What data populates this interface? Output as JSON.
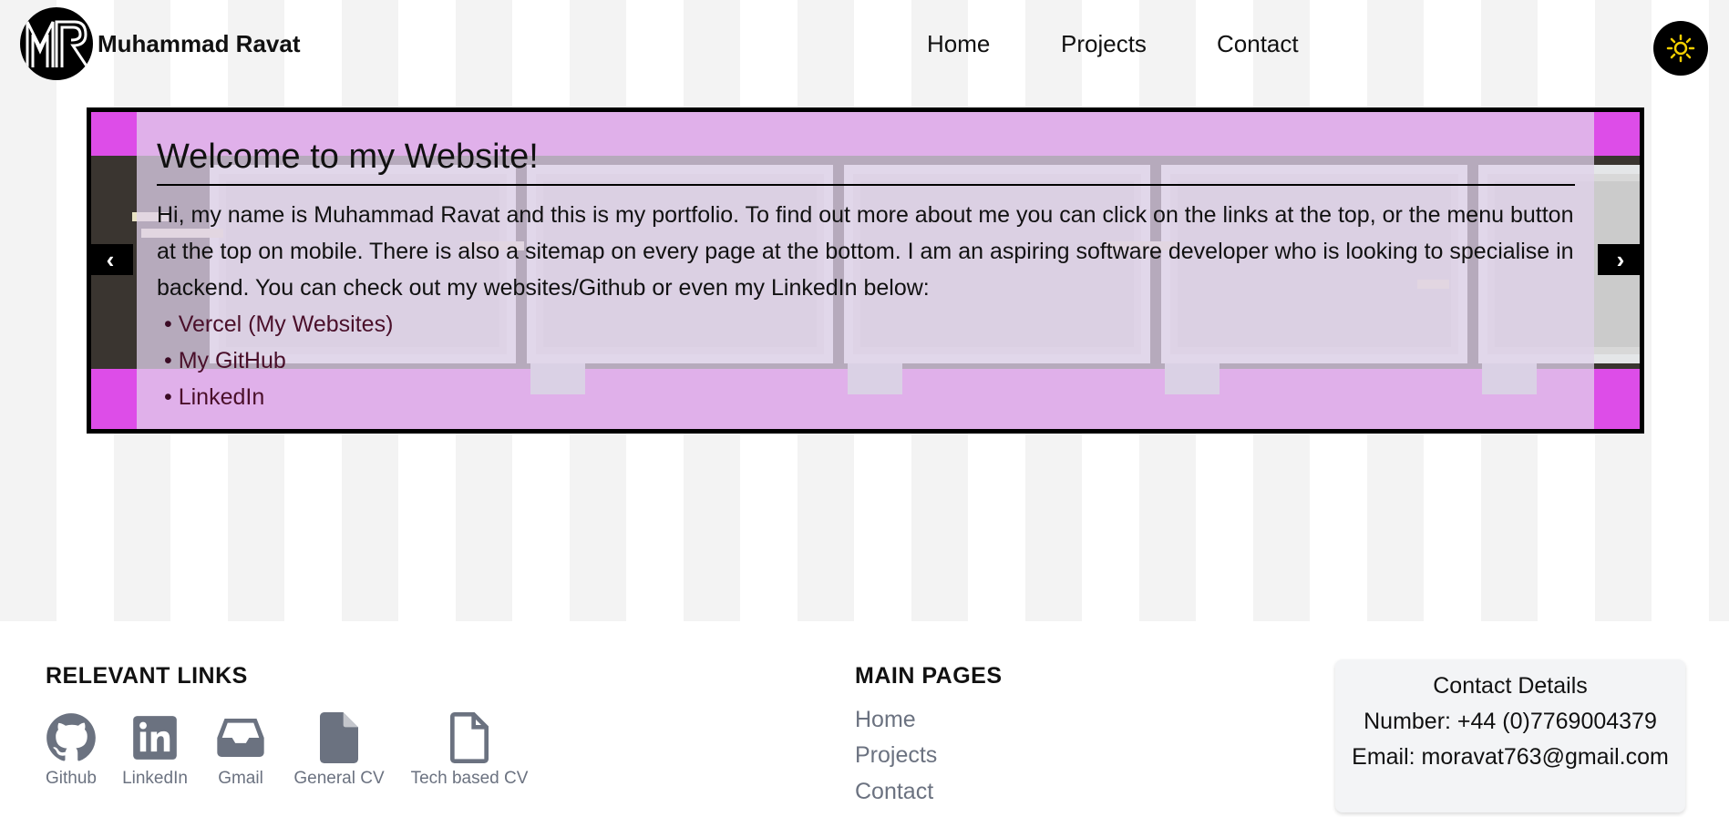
{
  "header": {
    "logo_text": "MR",
    "brand_name": "Muhammad Ravat",
    "nav": [
      "Home",
      "Projects",
      "Contact"
    ],
    "theme_icon": "sun-icon"
  },
  "carousel": {
    "title": "Welcome to my Website!",
    "intro": "Hi, my name is Muhammad Ravat and this is my portfolio. To find out more about me you can click on the links at the top, or the menu button at the top on mobile. There is also a sitemap on every page at the bottom. I am an aspiring software developer who is looking to specialise in backend. You can check out my websites/Github or even my LinkedIn below:",
    "links": [
      "Vercel (My Websites)",
      "My GitHub",
      "LinkedIn"
    ],
    "prev_label": "‹",
    "next_label": "›"
  },
  "footer": {
    "relevant_title": "RELEVANT LINKS",
    "relevant_links": [
      {
        "label": "Github",
        "icon": "github-icon"
      },
      {
        "label": "LinkedIn",
        "icon": "linkedin-icon"
      },
      {
        "label": "Gmail",
        "icon": "inbox-icon"
      },
      {
        "label": "General CV",
        "icon": "file-filled-icon"
      },
      {
        "label": "Tech based CV",
        "icon": "file-outline-icon"
      }
    ],
    "main_title": "MAIN PAGES",
    "main_pages": [
      "Home",
      "Projects",
      "Contact"
    ],
    "contact": {
      "title": "Contact Details",
      "number": "Number: +44 (0)7769004379",
      "email": "Email: moravat763@gmail.com"
    }
  },
  "colors": {
    "accent_pink": "#dd4de8",
    "link_text": "#4a0f2a",
    "footer_grey": "#6b7280"
  }
}
